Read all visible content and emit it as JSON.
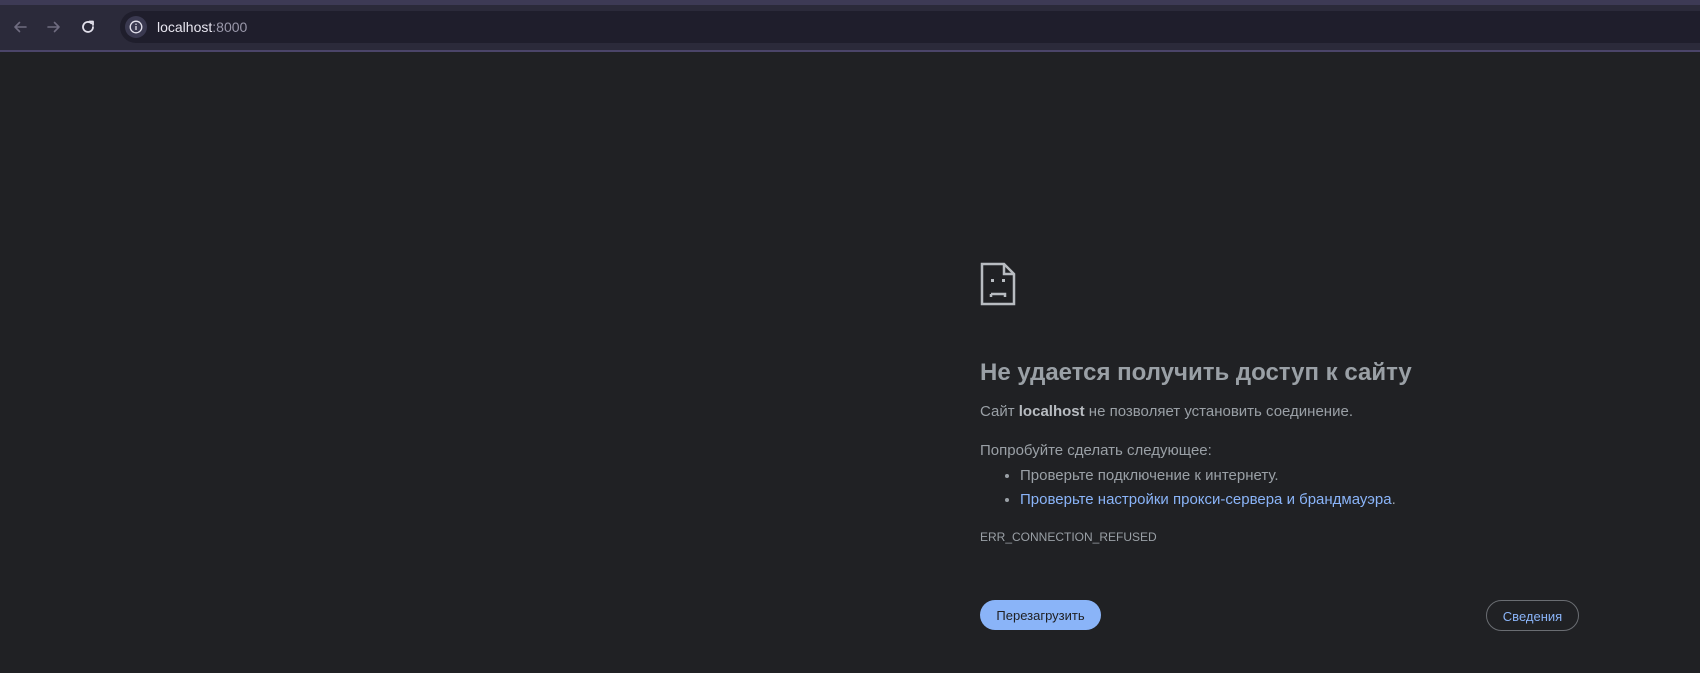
{
  "browser": {
    "url_host": "localhost",
    "url_port": ":8000",
    "icons": {
      "back": "arrow-back-icon",
      "forward": "arrow-forward-icon",
      "reload": "reload-icon",
      "site_info": "info-icon"
    }
  },
  "error_page": {
    "icon": "sad-document-icon",
    "title": "Не удается получить доступ к сайту",
    "description_prefix": "Сайт ",
    "description_host": "localhost",
    "description_suffix": " не позволяет установить соединение.",
    "suggestions_heading": "Попробуйте сделать следующее:",
    "suggestions": [
      {
        "text": "Проверьте подключение к интернету.",
        "link": false
      },
      {
        "text": "Проверьте настройки прокси-сервера и брандмауэра",
        "link": true,
        "trailing": "."
      }
    ],
    "error_code": "ERR_CONNECTION_REFUSED",
    "reload_label": "Перезагрузить",
    "details_label": "Сведения"
  },
  "colors": {
    "background": "#202124",
    "toolbar": "#2b2a3a",
    "text": "#9aa0a6",
    "link": "#8ab4f8"
  }
}
